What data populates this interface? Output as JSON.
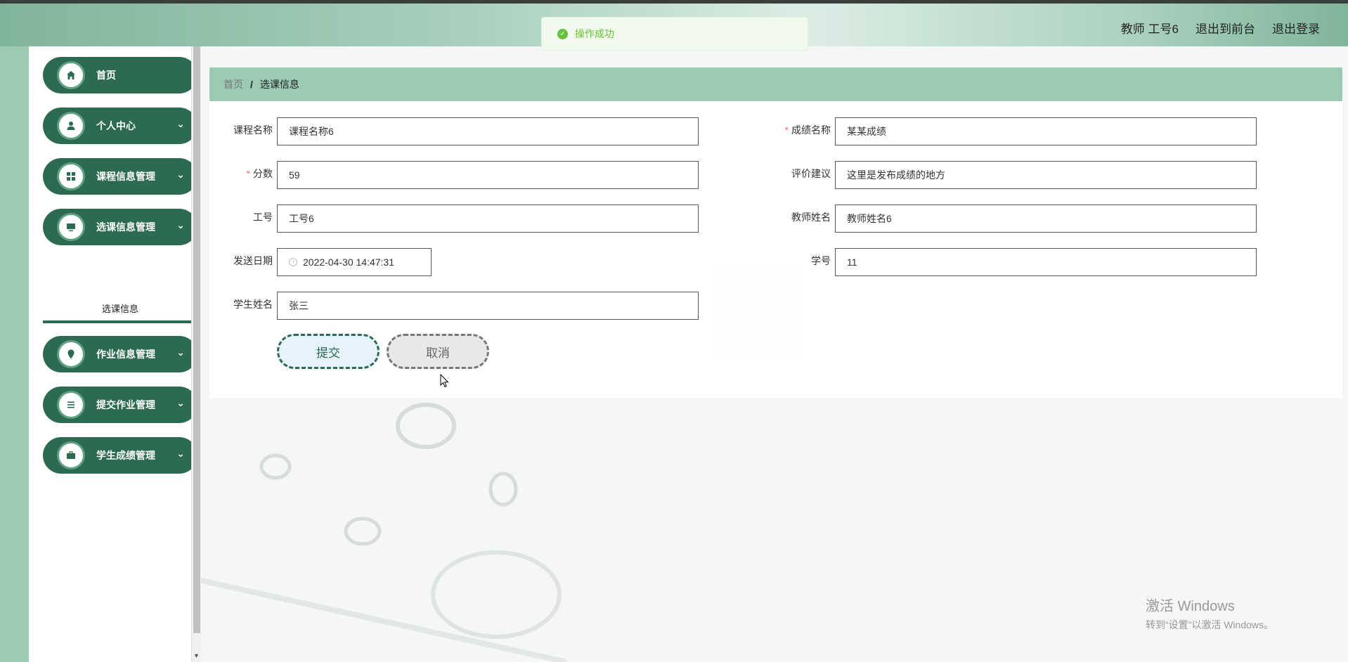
{
  "header": {
    "user_label": "教师 工号6",
    "back_frontend": "退出到前台",
    "logout": "退出登录"
  },
  "toast": {
    "message": "操作成功"
  },
  "sidebar": {
    "items": [
      {
        "label": "首页",
        "icon": "home-icon"
      },
      {
        "label": "个人中心",
        "icon": "user-icon"
      },
      {
        "label": "课程信息管理",
        "icon": "grid-icon"
      },
      {
        "label": "选课信息管理",
        "icon": "monitor-icon"
      },
      {
        "label": "作业信息管理",
        "icon": "location-icon"
      },
      {
        "label": "提交作业管理",
        "icon": "list-icon"
      },
      {
        "label": "学生成绩管理",
        "icon": "briefcase-icon"
      }
    ],
    "submenu": {
      "label": "选课信息"
    }
  },
  "breadcrumb": {
    "home": "首页",
    "separator": "/",
    "current": "选课信息"
  },
  "form": {
    "course_name": {
      "label": "课程名称",
      "value": "课程名称6"
    },
    "score_name": {
      "label": "成绩名称",
      "value": "某某成绩"
    },
    "score": {
      "label": "分数",
      "value": "59"
    },
    "evaluation": {
      "label": "评价建议",
      "value": "这里是发布成绩的地方"
    },
    "job_number": {
      "label": "工号",
      "value": "工号6"
    },
    "teacher_name": {
      "label": "教师姓名",
      "value": "教师姓名6"
    },
    "send_date": {
      "label": "发送日期",
      "value": "2022-04-30 14:47:31"
    },
    "student_id": {
      "label": "学号",
      "value": "11"
    },
    "student_name": {
      "label": "学生姓名",
      "value": "张三"
    },
    "submit": "提交",
    "cancel": "取消"
  },
  "watermark": {
    "line1": "激活 Windows",
    "line2": "转到“设置”以激活 Windows。"
  },
  "colors": {
    "primary": "#2c6a51",
    "accent": "#9bc9b2",
    "success": "#67c23a",
    "required": "#f56c6c"
  }
}
